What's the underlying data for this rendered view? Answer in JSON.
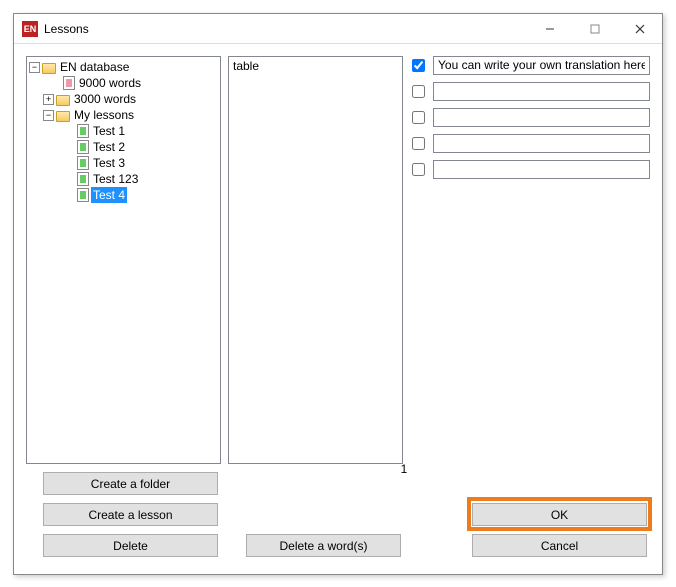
{
  "window": {
    "app_icon": "EN",
    "title": "Lessons"
  },
  "tree": {
    "root": {
      "label": "EN database",
      "words": "9000 words"
    },
    "n3000": "3000 words",
    "my_lessons": {
      "label": "My lessons",
      "items": [
        {
          "label": "Test 1",
          "selected": false
        },
        {
          "label": "Test 2",
          "selected": false
        },
        {
          "label": "Test 3",
          "selected": false
        },
        {
          "label": "Test 123",
          "selected": false
        },
        {
          "label": "Test 4",
          "selected": true
        }
      ]
    }
  },
  "words": {
    "items": [
      "table"
    ],
    "count": "1"
  },
  "translations": [
    {
      "checked": true,
      "value": "You can write your own translation here"
    },
    {
      "checked": false,
      "value": ""
    },
    {
      "checked": false,
      "value": ""
    },
    {
      "checked": false,
      "value": ""
    },
    {
      "checked": false,
      "value": ""
    }
  ],
  "buttons": {
    "create_folder": "Create a folder",
    "create_lesson": "Create a lesson",
    "delete": "Delete",
    "delete_word": "Delete a word(s)",
    "ok": "OK",
    "cancel": "Cancel"
  }
}
